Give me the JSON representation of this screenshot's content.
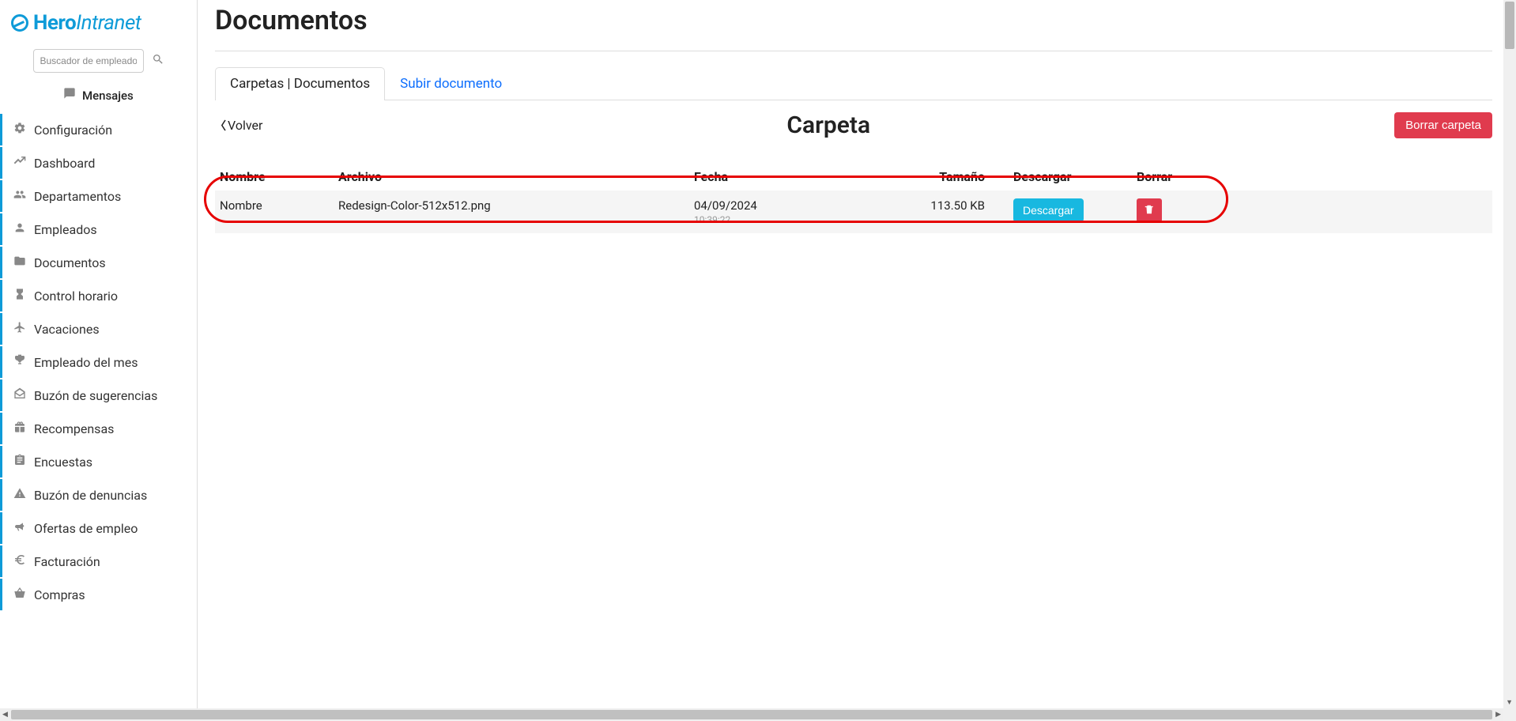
{
  "logo": {
    "part1": "Hero",
    "part2": "Intranet"
  },
  "search": {
    "placeholder": "Buscador de empleados..."
  },
  "messages_label": "Mensajes",
  "sidebar": {
    "items": [
      {
        "label": "Configuración"
      },
      {
        "label": "Dashboard"
      },
      {
        "label": "Departamentos"
      },
      {
        "label": "Empleados"
      },
      {
        "label": "Documentos"
      },
      {
        "label": "Control horario"
      },
      {
        "label": "Vacaciones"
      },
      {
        "label": "Empleado del mes"
      },
      {
        "label": "Buzón de sugerencias"
      },
      {
        "label": "Recompensas"
      },
      {
        "label": "Encuestas"
      },
      {
        "label": "Buzón de denuncias"
      },
      {
        "label": "Ofertas de empleo"
      },
      {
        "label": "Facturación"
      },
      {
        "label": "Compras"
      }
    ]
  },
  "page": {
    "title": "Documentos",
    "tabs": [
      {
        "label": "Carpetas | Documentos"
      },
      {
        "label": "Subir documento"
      }
    ],
    "back_label": "Volver",
    "folder_title": "Carpeta",
    "delete_folder_label": "Borrar carpeta"
  },
  "table": {
    "headers": {
      "nombre": "Nombre",
      "archivo": "Archivo",
      "fecha": "Fecha",
      "tamano": "Tamaño",
      "descargar": "Descargar",
      "borrar": "Borrar"
    },
    "rows": [
      {
        "nombre": "Nombre",
        "archivo": "Redesign-Color-512x512.png",
        "fecha": "04/09/2024",
        "hora": "10:39:22",
        "tamano": "113.50 KB",
        "descargar_label": "Descargar"
      }
    ]
  }
}
